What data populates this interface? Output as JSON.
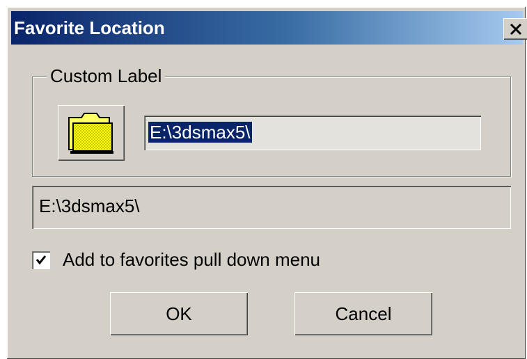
{
  "window": {
    "title": "Favorite Location",
    "close_label": "close"
  },
  "group": {
    "label": "Custom Label"
  },
  "label_input": {
    "value": "E:\\3dsmax5\\",
    "selected": true
  },
  "path_field": {
    "value": "E:\\3dsmax5\\"
  },
  "favorites_checkbox": {
    "label": "Add to favorites pull down menu",
    "checked": true
  },
  "buttons": {
    "ok_label": "OK",
    "cancel_label": "Cancel"
  },
  "icons": {
    "browse_button": "folder-icon",
    "close_button": "close-icon",
    "checkbox_mark": "checkmark-icon"
  },
  "colors": {
    "dialog_bg": "#d4d0c8",
    "title_start": "#0a246a",
    "title_end": "#a6caf0",
    "selection_bg": "#0a246a",
    "folder_fill": "#ffff00"
  }
}
